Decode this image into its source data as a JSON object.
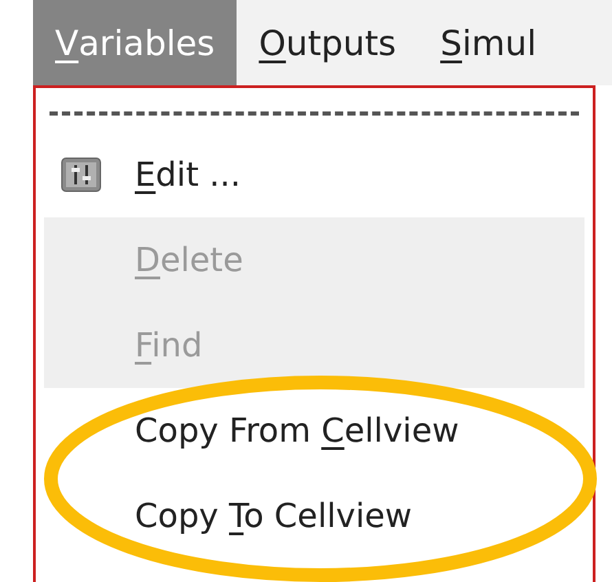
{
  "menubar": [
    {
      "key": "V",
      "after": "ariables",
      "selected": true
    },
    {
      "key": "O",
      "after": "utputs",
      "selected": false
    },
    {
      "key": "S",
      "after": "imul",
      "selected": false
    }
  ],
  "menu": {
    "tear_off": true,
    "items": [
      {
        "kind": "icon-item",
        "key": "E",
        "after": "dit ...",
        "disabled": false
      },
      {
        "kind": "item",
        "key": "D",
        "after": "elete",
        "disabled": true
      },
      {
        "kind": "item",
        "key": "F",
        "after": "ind",
        "disabled": true
      },
      {
        "kind": "item",
        "before": "Copy From ",
        "key": "C",
        "after": "ellview",
        "disabled": false
      },
      {
        "kind": "item",
        "before": "Copy ",
        "key": "T",
        "after": "o Cellview",
        "disabled": false
      }
    ]
  }
}
